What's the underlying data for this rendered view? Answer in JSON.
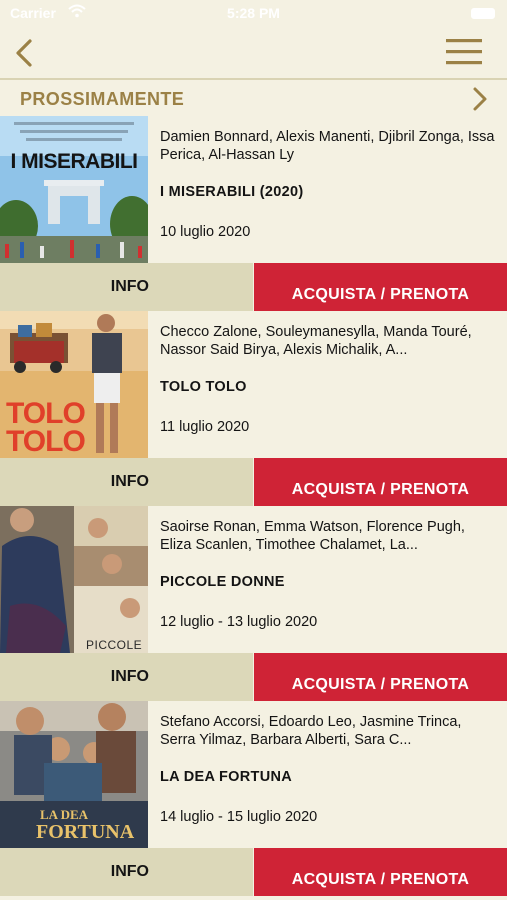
{
  "status_bar": {
    "carrier": "Carrier",
    "time": "5:28 PM",
    "wifi_icon": "wifi-icon",
    "battery_icon": "battery-icon"
  },
  "nav": {
    "back_icon": "chevron-left-icon",
    "menu_icon": "hamburger-menu-icon"
  },
  "section": {
    "title": "PROSSIMAMENTE",
    "next_icon": "chevron-right-icon"
  },
  "movies": [
    {
      "cast": "Damien Bonnard, Alexis Manenti, Djibril Zonga, Issa Perica, Al-Hassan Ly",
      "title": "I MISERABILI (2020)",
      "date": "10 luglio 2020",
      "poster_text": "I MISERABILI",
      "info_label": "INFO",
      "buy_label": "ACQUISTA / PRENOTA"
    },
    {
      "cast": "Checco Zalone, Souleymanesylla, Manda Touré, Nassor Said Birya, Alexis Michalik, A...",
      "title": "TOLO TOLO",
      "date": "11 luglio 2020",
      "poster_text_1": "TOLO",
      "poster_text_2": "TOLO",
      "info_label": "INFO",
      "buy_label": "ACQUISTA / PRENOTA"
    },
    {
      "cast": "Saoirse Ronan, Emma Watson, Florence Pugh, Eliza Scanlen, Timothee Chalamet, La...",
      "title": "PICCOLE DONNE",
      "date": "12 luglio - 13 luglio 2020",
      "poster_text": "PICCOLE",
      "info_label": "INFO",
      "buy_label": "ACQUISTA / PRENOTA"
    },
    {
      "cast": "Stefano Accorsi, Edoardo Leo, Jasmine Trinca, Serra Yilmaz, Barbara Alberti, Sara C...",
      "title": "LA DEA FORTUNA",
      "date": "14 luglio - 15 luglio 2020",
      "poster_text_1": "LA DEA",
      "poster_text_2": "FORTUNA",
      "info_label": "INFO",
      "buy_label": "ACQUISTA / PRENOTA"
    }
  ],
  "colors": {
    "background": "#f4f1e2",
    "accent_gold": "#9b8146",
    "buy_red": "#cf2336",
    "info_beige": "#dcd8b9"
  }
}
